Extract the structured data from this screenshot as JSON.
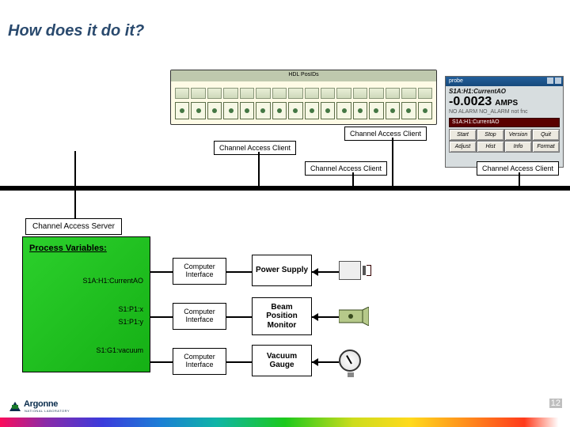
{
  "title": "How does it do it?",
  "client_label": "Channel Access Client",
  "server_label": "Channel Access Server",
  "pv_title": "Process Variables:",
  "pv": {
    "i1": "S1A:H1:CurrentAO",
    "i2a": "S1:P1:x",
    "i2b": "S1:P1:y",
    "i3": "S1:G1:vacuum"
  },
  "ci_label": "Computer Interface",
  "devices": {
    "d1": "Power Supply",
    "d2": "Beam Position Monitor",
    "d3": "Vacuum Gauge"
  },
  "app1": {
    "title": "HDL PosIDs"
  },
  "app2": {
    "title": "probe",
    "line1": "S1A:H1:CurrentAO",
    "value": "-0.0023",
    "unit": "AMPS",
    "alarm": "NO ALARM   NO_ALARM not fnc",
    "sel": "S1A:H1:CurrentAO",
    "buttons": [
      "Start",
      "Stop",
      "Version",
      "Quit",
      "Adjust",
      "Hist",
      "Info",
      "Format"
    ]
  },
  "footer": {
    "brand": "Argonne",
    "sub": "NATIONAL LABORATORY"
  },
  "page_num": "12"
}
